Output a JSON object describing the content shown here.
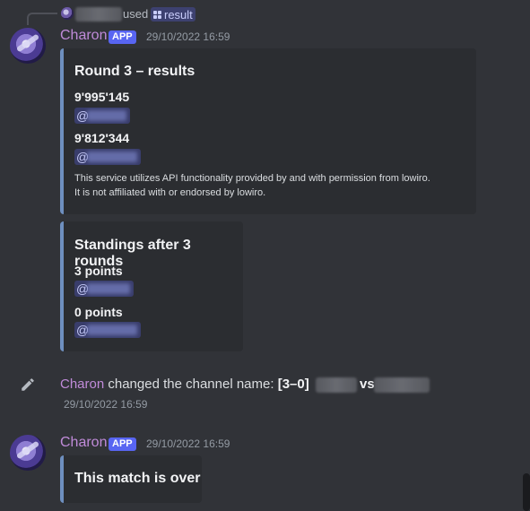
{
  "command_reply": {
    "used_text": "used",
    "command_name": "result"
  },
  "message1": {
    "author": "Charon",
    "badge": "APP",
    "timestamp": "29/10/2022 16:59",
    "embed1": {
      "title": "Round 3 – results",
      "fields": [
        {
          "name": "9'995'145",
          "mention": "@"
        },
        {
          "name": "9'812'344",
          "mention": "@"
        }
      ],
      "footer_line1": "This service utilizes API functionality provided by and with permission from lowiro.",
      "footer_line2": "It is not affiliated with or endorsed by lowiro."
    },
    "embed2": {
      "title": "Standings after 3 rounds",
      "fields": [
        {
          "name": "3 points",
          "mention": "@"
        },
        {
          "name": "0 points",
          "mention": "@"
        }
      ]
    }
  },
  "system_message": {
    "author": "Charon",
    "text": "changed the channel name:",
    "score": "[3–0]",
    "vs": "vs",
    "timestamp": "29/10/2022 16:59"
  },
  "message2": {
    "author": "Charon",
    "badge": "APP",
    "timestamp": "29/10/2022 16:59",
    "embed_title": "This match is over"
  },
  "colors": {
    "background": "#313338",
    "embed_background": "#2b2d31",
    "embed_border": "#6e8fbf",
    "author_color": "#c08bd9",
    "badge_color": "#5865f2",
    "mention_background": "rgba(88,101,242,0.3)"
  }
}
